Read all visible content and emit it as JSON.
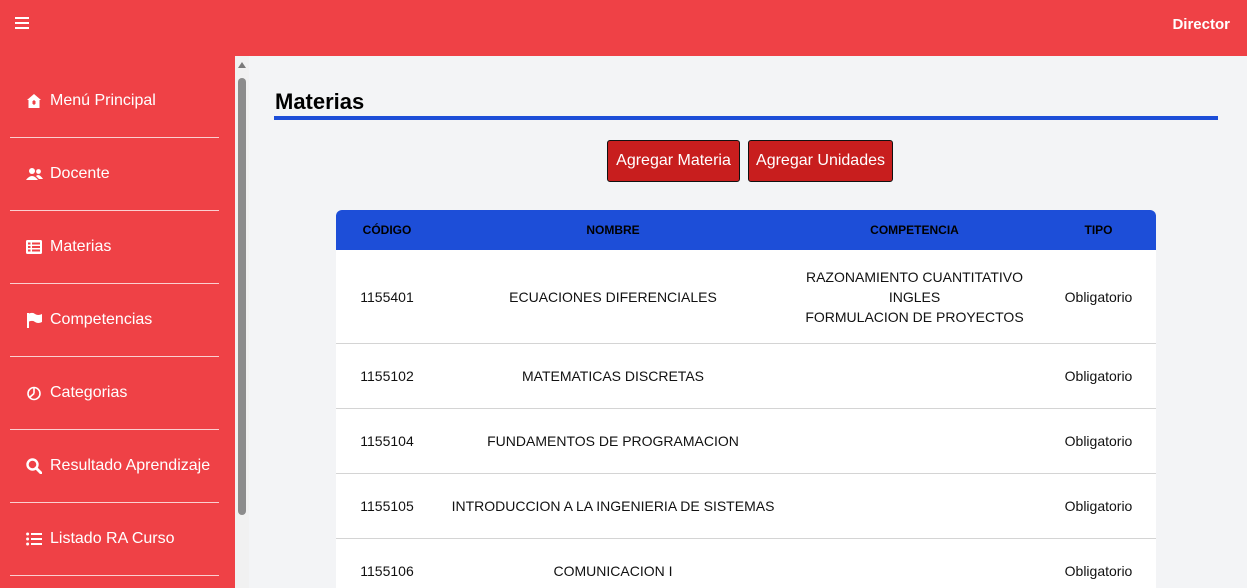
{
  "header": {
    "menu_icon": "hamburger-icon",
    "role": "Director"
  },
  "sidebar": {
    "items": [
      {
        "label": "Menú Principal",
        "icon": "home-icon"
      },
      {
        "label": "Docente",
        "icon": "users-icon"
      },
      {
        "label": "Materias",
        "icon": "list-icon"
      },
      {
        "label": "Competencias",
        "icon": "flag-icon"
      },
      {
        "label": "Categorias",
        "icon": "pie-chart-icon"
      },
      {
        "label": "Resultado Aprendizaje",
        "icon": "search-icon"
      },
      {
        "label": "Listado RA Curso",
        "icon": "list-ul-icon"
      }
    ]
  },
  "main": {
    "title": "Materias",
    "buttons": {
      "add_materia": "Agregar Materia",
      "add_unidades": "Agregar Unidades"
    },
    "table": {
      "headers": {
        "codigo": "CÓDIGO",
        "nombre": "NOMBRE",
        "competencia": "COMPETENCIA",
        "tipo": "TIPO"
      },
      "rows": [
        {
          "codigo": "1155401",
          "nombre": "ECUACIONES DIFERENCIALES",
          "competencias": [
            "RAZONAMIENTO CUANTITATIVO",
            "INGLES",
            "FORMULACION DE PROYECTOS"
          ],
          "tipo": "Obligatorio"
        },
        {
          "codigo": "1155102",
          "nombre": "MATEMATICAS DISCRETAS",
          "competencias": [],
          "tipo": "Obligatorio"
        },
        {
          "codigo": "1155104",
          "nombre": "FUNDAMENTOS DE PROGRAMACION",
          "competencias": [],
          "tipo": "Obligatorio"
        },
        {
          "codigo": "1155105",
          "nombre": "INTRODUCCION A LA INGENIERIA DE SISTEMAS",
          "competencias": [],
          "tipo": "Obligatorio"
        },
        {
          "codigo": "1155106",
          "nombre": "COMUNICACION I",
          "competencias": [],
          "tipo": "Obligatorio"
        }
      ]
    }
  },
  "colors": {
    "brand_red": "#ef4146",
    "button_red": "#c81e1e",
    "accent_blue": "#1d4ed8"
  }
}
